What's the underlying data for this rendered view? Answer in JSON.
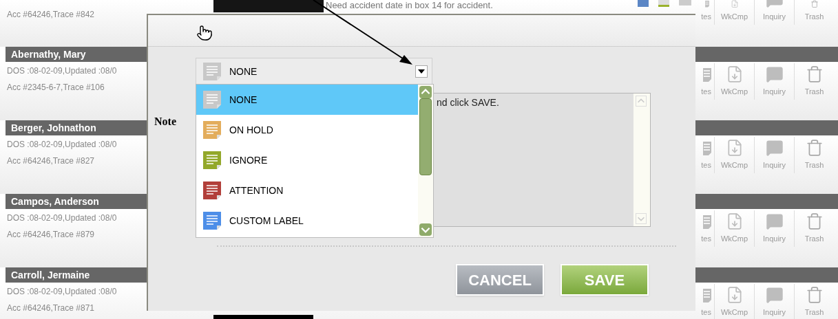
{
  "top_row": {
    "account": "Acc #64246,Trace #842",
    "message": "Need accident date in box 14 for accident.",
    "actions": [
      {
        "kind": "notes",
        "label": "tes"
      },
      {
        "kind": "workcomp",
        "label": "WkCmp"
      },
      {
        "kind": "inquiry",
        "label": "Inquiry"
      },
      {
        "kind": "trash",
        "label": "Trash"
      }
    ]
  },
  "patients": [
    {
      "name": "Abernathy, Mary",
      "dos": "DOS :08-02-09,Updated :08/0",
      "account": "Acc #2345-6-7,Trace #106",
      "actions": [
        {
          "kind": "notes",
          "label": "tes"
        },
        {
          "kind": "workcomp",
          "label": "WkCmp"
        },
        {
          "kind": "inquiry",
          "label": "Inquiry"
        },
        {
          "kind": "trash",
          "label": "Trash"
        }
      ]
    },
    {
      "name": "Berger, Johnathon",
      "dos": "DOS :08-02-09,Updated :08/0",
      "account": "Acc #64246,Trace #827",
      "actions": [
        {
          "kind": "notes",
          "label": "tes"
        },
        {
          "kind": "workcomp",
          "label": "WkCmp"
        },
        {
          "kind": "inquiry",
          "label": "Inquiry"
        },
        {
          "kind": "trash",
          "label": "Trash"
        }
      ]
    },
    {
      "name": "Campos, Anderson",
      "dos": "DOS :08-02-09,Updated :08/0",
      "account": "Acc #64246,Trace #879",
      "actions": [
        {
          "kind": "notes",
          "label": "tes"
        },
        {
          "kind": "workcomp",
          "label": "WkCmp"
        },
        {
          "kind": "inquiry",
          "label": "Inquiry"
        },
        {
          "kind": "trash",
          "label": "Trash"
        }
      ]
    },
    {
      "name": "Carroll, Jermaine",
      "dos": "DOS :08-02-09,Updated :08/0",
      "account": "Acc #64246,Trace #871",
      "actions": [
        {
          "kind": "notes",
          "label": "tes"
        },
        {
          "kind": "workcomp",
          "label": "WkCmp"
        },
        {
          "kind": "inquiry",
          "label": "Inquiry"
        },
        {
          "kind": "trash",
          "label": "Trash"
        }
      ]
    }
  ],
  "dialog": {
    "note_label": "Note",
    "select": {
      "value": "NONE",
      "color": "#c8c8c8"
    },
    "options": [
      {
        "label": "NONE",
        "color": "#c8c8c8",
        "selected": true
      },
      {
        "label": "ON HOLD",
        "color": "#e3ad5c",
        "selected": false
      },
      {
        "label": "IGNORE",
        "color": "#93a82a",
        "selected": false
      },
      {
        "label": "ATTENTION",
        "color": "#b23f3a",
        "selected": false
      },
      {
        "label": "CUSTOM LABEL",
        "color": "#4d8ee8",
        "selected": false
      }
    ],
    "note_text": "nd click SAVE.",
    "buttons": [
      {
        "kind": "cancel",
        "label": "CANCEL"
      },
      {
        "kind": "save",
        "label": "SAVE"
      }
    ]
  }
}
